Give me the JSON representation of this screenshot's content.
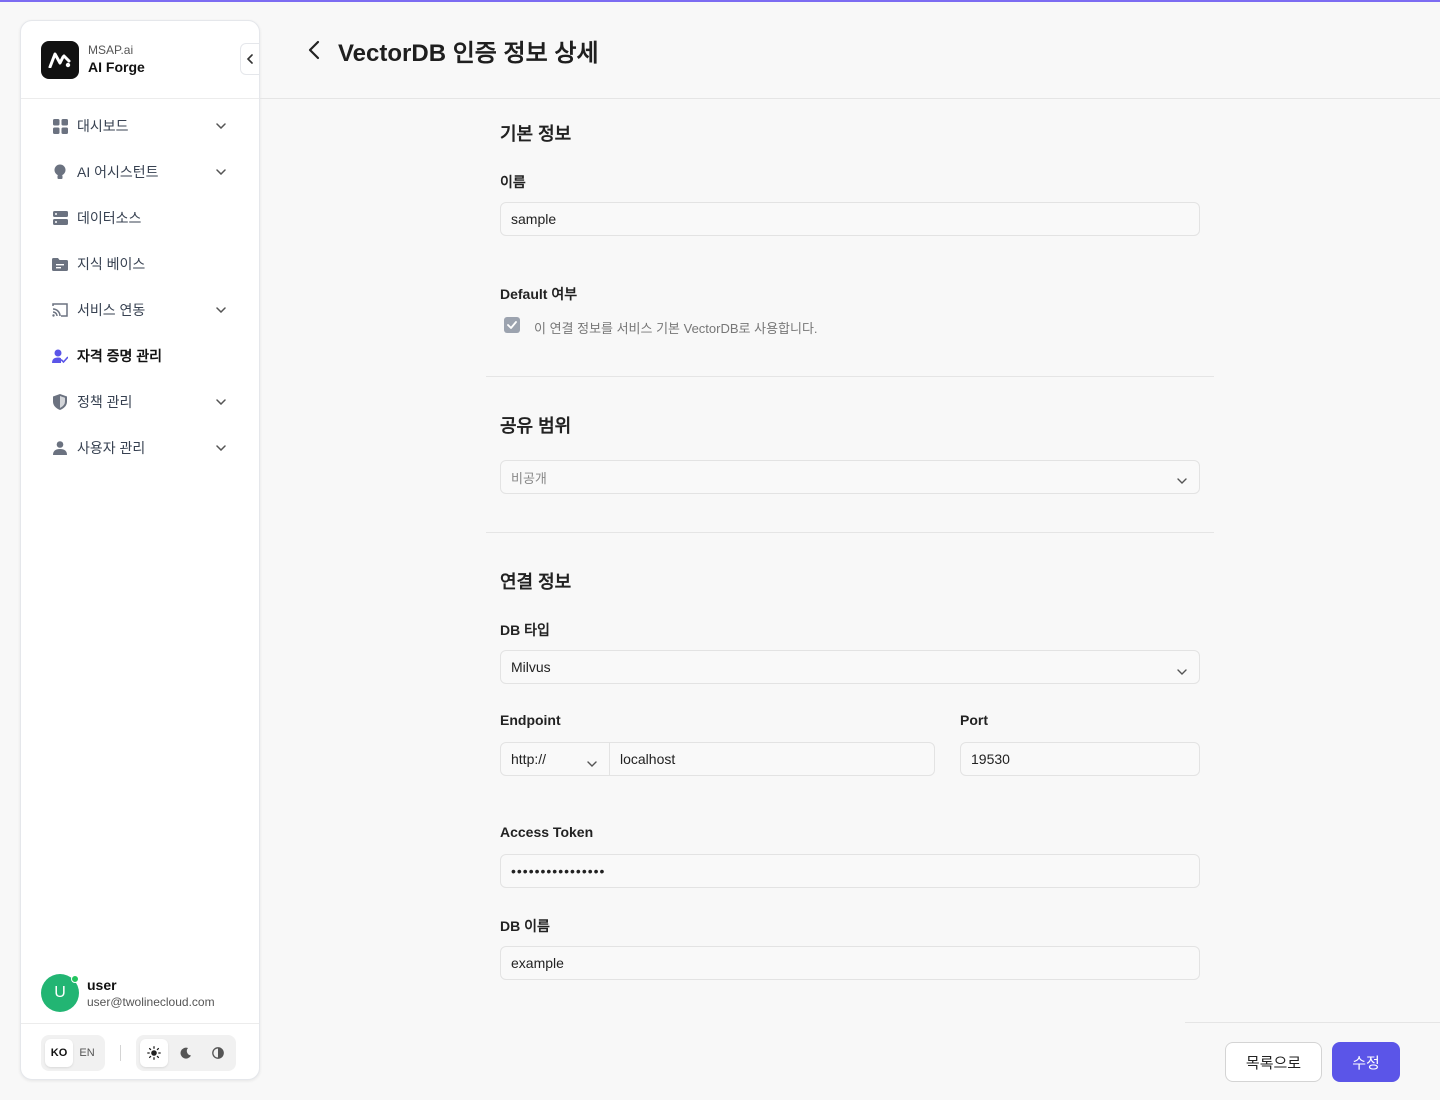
{
  "brand": {
    "sub": "MSAP.ai",
    "name": "AI Forge"
  },
  "nav": {
    "items": [
      {
        "label": "대시보드",
        "icon": "dashboard-icon"
      },
      {
        "label": "AI 어시스턴트",
        "icon": "lightbulb-icon"
      },
      {
        "label": "데이터소스",
        "icon": "database-icon"
      },
      {
        "label": "지식 베이스",
        "icon": "folder-icon"
      },
      {
        "label": "서비스 연동",
        "icon": "cast-icon"
      },
      {
        "label": "자격 증명 관리",
        "icon": "credential-icon"
      },
      {
        "label": "정책 관리",
        "icon": "shield-icon"
      },
      {
        "label": "사용자 관리",
        "icon": "person-icon"
      }
    ],
    "active": "자격 증명 관리"
  },
  "user": {
    "initial": "U",
    "name": "user",
    "email": "user@twolinecloud.com"
  },
  "lang": {
    "ko": "KO",
    "en": "EN",
    "selected": "KO"
  },
  "header": {
    "title": "VectorDB 인증 정보 상세"
  },
  "basic": {
    "title": "기본 정보",
    "name_label": "이름",
    "name_value": "sample",
    "default_label": "Default 여부",
    "default_text": "이 연결 정보를 서비스 기본 VectorDB로 사용합니다.",
    "default_checked": true
  },
  "share": {
    "title": "공유 범위",
    "value": "비공개"
  },
  "conn": {
    "title": "연결 정보",
    "db_type_label": "DB 타입",
    "db_type_value": "Milvus",
    "endpoint_label": "Endpoint",
    "protocol": "http://",
    "host": "localhost",
    "port_label": "Port",
    "port_value": "19530",
    "token_label": "Access Token",
    "token_value": "••••••••••••••••",
    "dbname_label": "DB 이름",
    "dbname_value": "example"
  },
  "actions": {
    "list": "목록으로",
    "edit": "수정"
  },
  "colors": {
    "accent": "#5b55e8",
    "avatar": "#22b573"
  }
}
